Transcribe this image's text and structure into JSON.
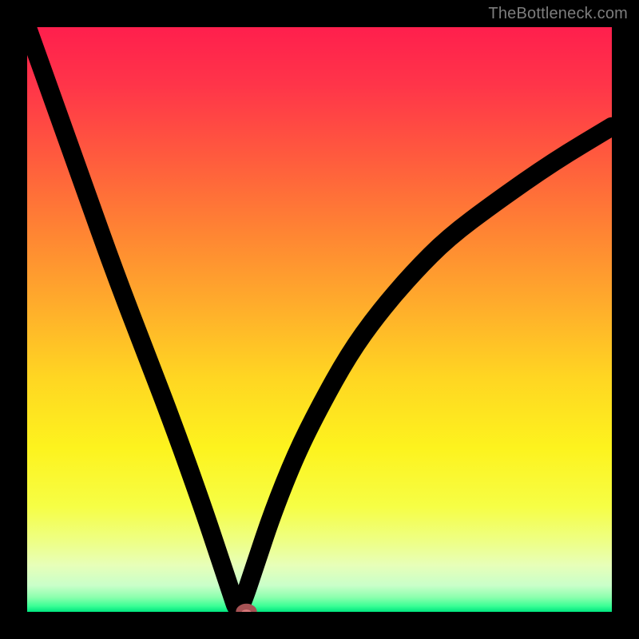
{
  "watermark": "TheBottleneck.com",
  "chart_data": {
    "type": "line",
    "title": "",
    "xlabel": "",
    "ylabel": "",
    "xlim": [
      0,
      100
    ],
    "ylim": [
      0,
      100
    ],
    "grid": false,
    "legend": false,
    "optimum_x": 36,
    "series": [
      {
        "name": "bottleneck-curve",
        "x": [
          0,
          5,
          10,
          15,
          20,
          25,
          30,
          33,
          35,
          36,
          37,
          39,
          42,
          46,
          50,
          55,
          60,
          66,
          72,
          80,
          90,
          100
        ],
        "values": [
          100,
          86,
          72,
          58,
          45,
          32,
          18,
          9,
          3,
          0,
          2,
          8,
          17,
          27,
          35,
          44,
          51,
          58,
          64,
          70,
          77,
          83
        ]
      }
    ],
    "marker": {
      "x": 37.5,
      "y": 0,
      "rx": 1.3,
      "ry": 0.9
    },
    "gradient_stops": [
      {
        "offset": 0.0,
        "color": "#FF1F4D"
      },
      {
        "offset": 0.1,
        "color": "#FF3549"
      },
      {
        "offset": 0.22,
        "color": "#FF5A3E"
      },
      {
        "offset": 0.35,
        "color": "#FF8433"
      },
      {
        "offset": 0.48,
        "color": "#FFAE2B"
      },
      {
        "offset": 0.6,
        "color": "#FFD622"
      },
      {
        "offset": 0.72,
        "color": "#FDF31E"
      },
      {
        "offset": 0.82,
        "color": "#F6FE45"
      },
      {
        "offset": 0.88,
        "color": "#EEFF86"
      },
      {
        "offset": 0.92,
        "color": "#E7FFB8"
      },
      {
        "offset": 0.955,
        "color": "#C9FFC9"
      },
      {
        "offset": 0.975,
        "color": "#8CFFAE"
      },
      {
        "offset": 0.99,
        "color": "#3BFF95"
      },
      {
        "offset": 1.0,
        "color": "#00E57F"
      }
    ]
  }
}
